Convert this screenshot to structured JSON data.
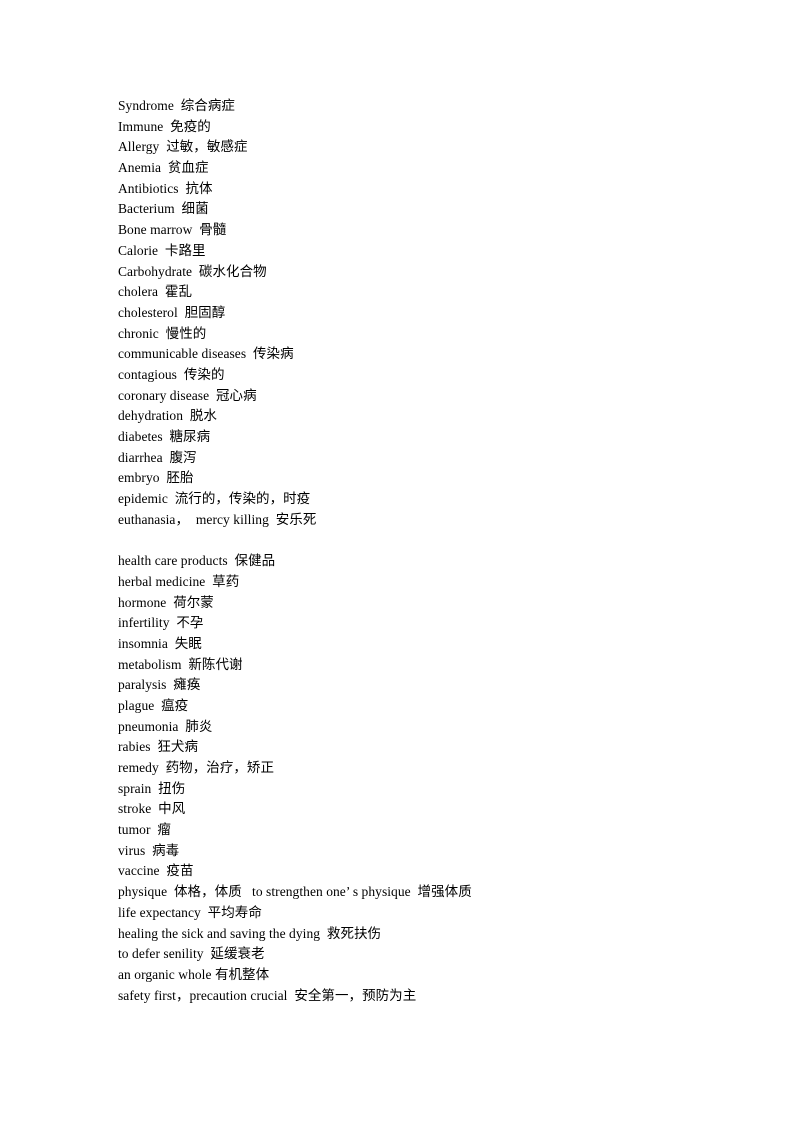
{
  "document": {
    "title": "Medical Vocabulary List",
    "background_color": "#ffffff",
    "text_color": "#000000",
    "lines": [
      {
        "id": "syndrome",
        "text": "Syndrome  综合病症"
      },
      {
        "id": "immune",
        "text": "Immune  免疫的"
      },
      {
        "id": "allergy",
        "text": "Allergy  过敏，敏感症"
      },
      {
        "id": "anemia",
        "text": "Anemia  贫血症"
      },
      {
        "id": "antibiotics",
        "text": "Antibiotics  抗体"
      },
      {
        "id": "bacterium",
        "text": "Bacterium  细菌"
      },
      {
        "id": "bone-marrow",
        "text": "Bone marrow  骨髓"
      },
      {
        "id": "calorie",
        "text": "Calorie  卡路里"
      },
      {
        "id": "carbohydrate",
        "text": "Carbohydrate  碳水化合物"
      },
      {
        "id": "cholera",
        "text": "cholera  霍乱"
      },
      {
        "id": "cholesterol",
        "text": "cholesterol  胆固醇"
      },
      {
        "id": "chronic",
        "text": "chronic  慢性的"
      },
      {
        "id": "communicable-diseases",
        "text": "communicable diseases  传染病"
      },
      {
        "id": "contagious",
        "text": "contagious  传染的"
      },
      {
        "id": "coronary-disease",
        "text": "coronary disease  冠心病"
      },
      {
        "id": "dehydration",
        "text": "dehydration  脱水"
      },
      {
        "id": "diabetes",
        "text": "diabetes  糖尿病"
      },
      {
        "id": "diarrhea",
        "text": "diarrhea  腹泻"
      },
      {
        "id": "embryo",
        "text": "embryo  胚胎"
      },
      {
        "id": "epidemic",
        "text": "epidemic  流行的，传染的，时疫"
      },
      {
        "id": "euthanasia",
        "text": "euthanasia，  mercy killing  安乐死"
      },
      {
        "id": "spacer-1",
        "text": ""
      },
      {
        "id": "health-care-products",
        "text": "health care products  保健品"
      },
      {
        "id": "herbal-medicine",
        "text": "herbal medicine  草药"
      },
      {
        "id": "hormone",
        "text": "hormone  荷尔蒙"
      },
      {
        "id": "infertility",
        "text": "infertility  不孕"
      },
      {
        "id": "insomnia",
        "text": "insomnia  失眠"
      },
      {
        "id": "metabolism",
        "text": "metabolism  新陈代谢"
      },
      {
        "id": "paralysis",
        "text": "paralysis  瘫痪"
      },
      {
        "id": "plague",
        "text": "plague  瘟疫"
      },
      {
        "id": "pneumonia",
        "text": "pneumonia  肺炎"
      },
      {
        "id": "rabies",
        "text": "rabies  狂犬病"
      },
      {
        "id": "remedy",
        "text": "remedy  药物，治疗，矫正"
      },
      {
        "id": "sprain",
        "text": "sprain  扭伤"
      },
      {
        "id": "stroke",
        "text": "stroke  中风"
      },
      {
        "id": "tumor",
        "text": "tumor  瘤"
      },
      {
        "id": "virus",
        "text": "virus  病毒"
      },
      {
        "id": "vaccine",
        "text": "vaccine  疫苗"
      },
      {
        "id": "physique",
        "text": "physique  体格，体质   to strengthen one’ s physique  增强体质"
      },
      {
        "id": "life-expectancy",
        "text": "life expectancy  平均寿命"
      },
      {
        "id": "healing-the-sick",
        "text": "healing the sick and saving the dying  救死扶伤"
      },
      {
        "id": "defer-senility",
        "text": "to defer senility  延缓衰老"
      },
      {
        "id": "organic-whole",
        "text": "an organic whole 有机整体"
      },
      {
        "id": "safety-first",
        "text": "safety first，precaution crucial  安全第一，预防为主"
      }
    ]
  }
}
